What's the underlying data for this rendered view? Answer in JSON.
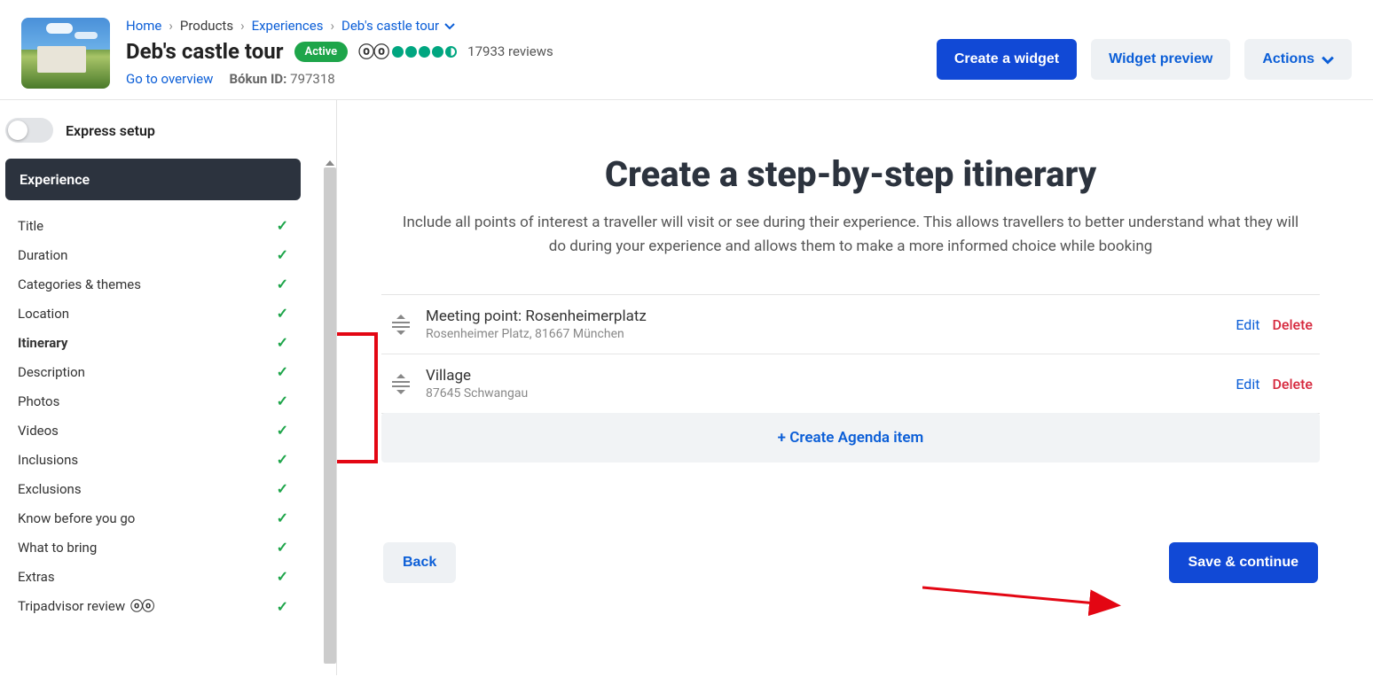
{
  "breadcrumb": {
    "home": "Home",
    "products": "Products",
    "experiences": "Experiences",
    "current": "Deb's castle tour"
  },
  "header": {
    "title": "Deb's castle tour",
    "status": "Active",
    "reviews_count": "17933 reviews",
    "overview_link": "Go to overview",
    "bokun_id_label": "Bókun ID:",
    "bokun_id_value": "797318"
  },
  "actions": {
    "create_widget": "Create a widget",
    "widget_preview": "Widget preview",
    "actions": "Actions"
  },
  "sidebar": {
    "express_label": "Express setup",
    "section": "Experience",
    "items": [
      {
        "label": "Title",
        "done": true,
        "active": false
      },
      {
        "label": "Duration",
        "done": true,
        "active": false
      },
      {
        "label": "Categories & themes",
        "done": true,
        "active": false
      },
      {
        "label": "Location",
        "done": true,
        "active": false
      },
      {
        "label": "Itinerary",
        "done": true,
        "active": true
      },
      {
        "label": "Description",
        "done": true,
        "active": false
      },
      {
        "label": "Photos",
        "done": true,
        "active": false
      },
      {
        "label": "Videos",
        "done": true,
        "active": false
      },
      {
        "label": "Inclusions",
        "done": true,
        "active": false
      },
      {
        "label": "Exclusions",
        "done": true,
        "active": false
      },
      {
        "label": "Know before you go",
        "done": true,
        "active": false
      },
      {
        "label": "What to bring",
        "done": true,
        "active": false
      },
      {
        "label": "Extras",
        "done": true,
        "active": false
      },
      {
        "label": "Tripadvisor review",
        "done": true,
        "active": false,
        "icon": "owl"
      }
    ]
  },
  "main": {
    "title": "Create a step-by-step itinerary",
    "description": "Include all points of interest a traveller will visit or see during their experience. This allows travellers to better understand what they will do during your experience and allows them to make a more informed choice while booking",
    "items": [
      {
        "title": "Meeting point: Rosenheimerplatz",
        "subtitle": "Rosenheimer Platz, 81667 München"
      },
      {
        "title": "Village",
        "subtitle": "87645 Schwangau"
      }
    ],
    "edit_label": "Edit",
    "delete_label": "Delete",
    "create_label": "+ Create Agenda item",
    "back_label": "Back",
    "save_label": "Save & continue"
  }
}
